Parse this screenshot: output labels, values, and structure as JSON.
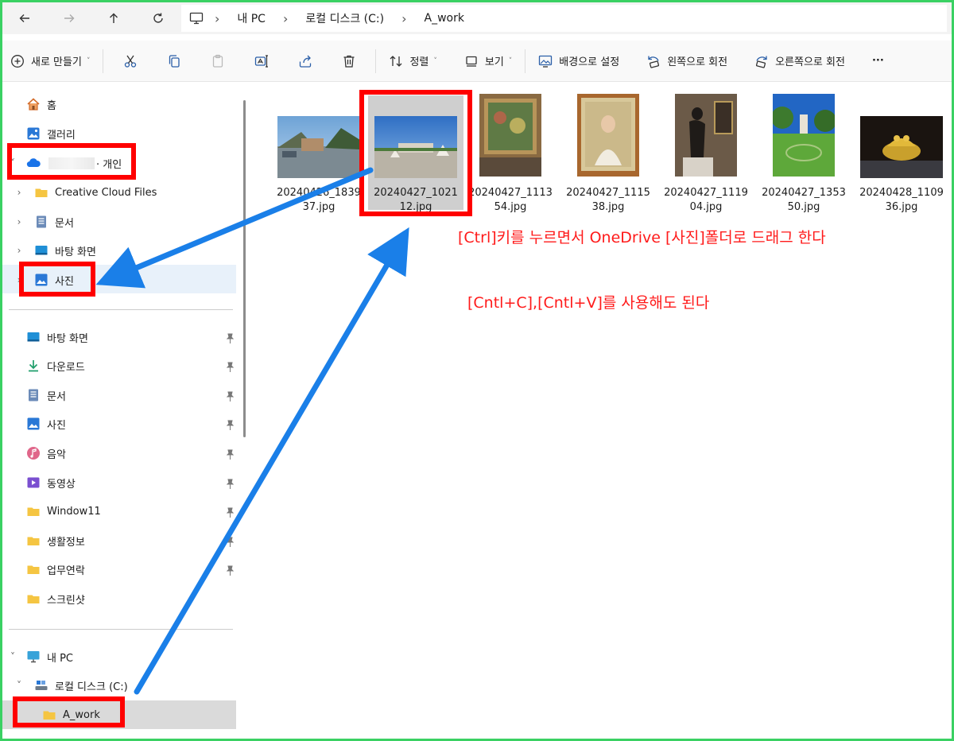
{
  "breadcrumb": [
    "내 PC",
    "로컬 디스크 (C:)",
    "A_work"
  ],
  "toolbar": {
    "new_label": "새로 만들기",
    "sort_label": "정렬",
    "view_label": "보기",
    "set_background_label": "배경으로 설정",
    "rotate_left_label": "왼쪽으로 회전",
    "rotate_right_label": "오른쪽으로 회전",
    "more_label": "···"
  },
  "sidebar": {
    "home": "홈",
    "gallery": "갤러리",
    "onedrive_suffix": "· 개인",
    "onedrive_children": [
      "Creative Cloud Files",
      "문서",
      "바탕 화면",
      "사진"
    ],
    "quick_access": [
      "바탕 화면",
      "다운로드",
      "문서",
      "사진",
      "음악",
      "동영상",
      "Window11",
      "생활정보",
      "업무연락",
      "스크린샷"
    ],
    "this_pc": "내 PC",
    "local_disk": "로컬 디스크 (C:)",
    "a_work": "A_work"
  },
  "files": [
    {
      "name": "20240426_183937.jpg",
      "line1": "20240426_1839",
      "line2": "37.jpg"
    },
    {
      "name": "20240427_102112.jpg",
      "line1": "20240427_1021",
      "line2": "12.jpg"
    },
    {
      "name": "20240427_111354.jpg",
      "line1": "20240427_1113",
      "line2": "54.jpg"
    },
    {
      "name": "20240427_111538.jpg",
      "line1": "20240427_1115",
      "line2": "38.jpg"
    },
    {
      "name": "20240427_111904.jpg",
      "line1": "20240427_1119",
      "line2": "04.jpg"
    },
    {
      "name": "20240427_135350.jpg",
      "line1": "20240427_1353",
      "line2": "50.jpg"
    },
    {
      "name": "20240428_110936.jpg",
      "line1": "20240428_1109",
      "line2": "36.jpg"
    }
  ],
  "annotations": {
    "line1": "[Ctrl]키를 누르면서 OneDrive [사진]폴더로 드래그 한다",
    "line2": "[Cntl+C],[Cntl+V]를 사용해도 된다"
  },
  "colors": {
    "annotation": "#ff0000",
    "arrow": "#1a7fe8",
    "frame": "#3ad163",
    "folder": "#f5c542"
  }
}
